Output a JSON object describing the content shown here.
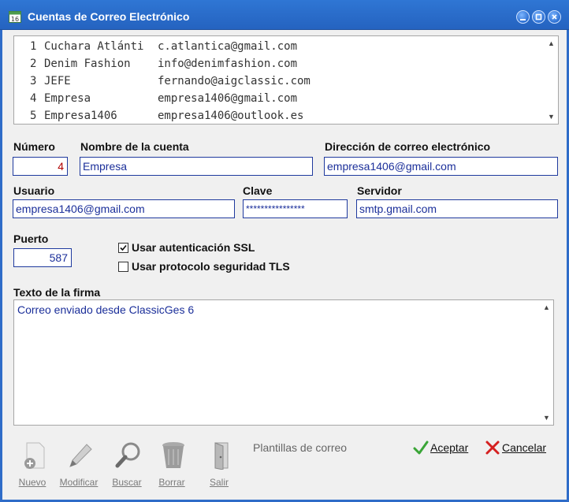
{
  "window": {
    "title": "Cuentas de Correo Electrónico"
  },
  "accounts_list": {
    "rows": [
      {
        "num": "1",
        "name": "Cuchara Atlánti",
        "email": "c.atlantica@gmail.com"
      },
      {
        "num": "2",
        "name": "Denim Fashion",
        "email": "info@denimfashion.com"
      },
      {
        "num": "3",
        "name": "JEFE",
        "email": "fernando@aigclassic.com"
      },
      {
        "num": "4",
        "name": "Empresa",
        "email": "empresa1406@gmail.com"
      },
      {
        "num": "5",
        "name": "Empresa1406",
        "email": "empresa1406@outlook.es"
      }
    ]
  },
  "form": {
    "numero_label": "Número",
    "numero_value": "4",
    "nombre_label": "Nombre de la cuenta",
    "nombre_value": "Empresa",
    "direccion_label": "Dirección de correo electrónico",
    "direccion_value": "empresa1406@gmail.com",
    "usuario_label": "Usuario",
    "usuario_value": "empresa1406@gmail.com",
    "clave_label": "Clave",
    "clave_value": "****************",
    "servidor_label": "Servidor",
    "servidor_value": "smtp.gmail.com",
    "puerto_label": "Puerto",
    "puerto_value": "587",
    "ssl_label": "Usar autenticación SSL",
    "ssl_checked": true,
    "tls_label": "Usar protocolo seguridad TLS",
    "tls_checked": false,
    "firma_label": "Texto de la firma",
    "firma_value": "Correo enviado desde ClassicGes 6"
  },
  "toolbar": {
    "nuevo": "Nuevo",
    "modificar": "Modificar",
    "buscar": "Buscar",
    "borrar": "Borrar",
    "salir": "Salir",
    "plantillas": "Plantillas de correo",
    "aceptar": "Aceptar",
    "cancelar": "Cancelar"
  },
  "icons": {
    "app": "calendar-icon",
    "minimize": "minimize-icon",
    "restore": "restore-icon",
    "close": "close-icon",
    "nuevo": "new-document-icon",
    "modificar": "pencil-icon",
    "buscar": "magnifier-icon",
    "borrar": "trash-icon",
    "salir": "door-icon",
    "aceptar": "check-icon",
    "cancelar": "x-icon"
  },
  "colors": {
    "title_bar": "#2f76d4",
    "field_text": "#1b2f9a",
    "field_border": "#1f3a9e",
    "numero_text": "#b00000"
  }
}
